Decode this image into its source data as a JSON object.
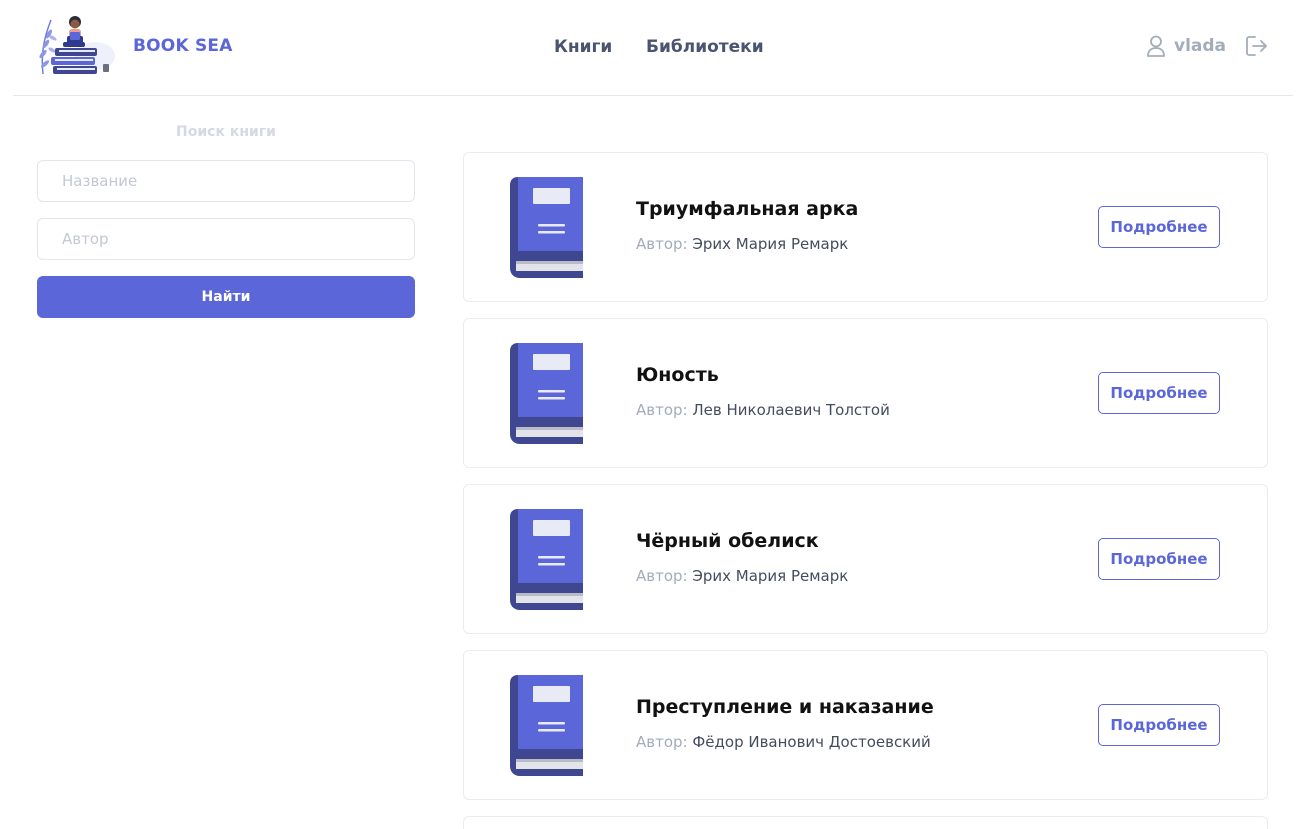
{
  "header": {
    "brand": "BOOK SEA",
    "nav": [
      "Книги",
      "Библиотеки"
    ],
    "username": "vlada"
  },
  "search": {
    "title": "Поиск книги",
    "title_placeholder": "Название",
    "author_placeholder": "Автор",
    "button": "Найти"
  },
  "books": [
    {
      "title": "Триумфальная арка",
      "author_label": "Автор:",
      "author": "Эрих Мария Ремарк",
      "button": "Подробнее"
    },
    {
      "title": "Юность",
      "author_label": "Автор:",
      "author": "Лев Николаевич Толстой",
      "button": "Подробнее"
    },
    {
      "title": "Чёрный обелиск",
      "author_label": "Автор:",
      "author": "Эрих Мария Ремарк",
      "button": "Подробнее"
    },
    {
      "title": "Преступление и наказание",
      "author_label": "Автор:",
      "author": "Фёдор Иванович Достоевский",
      "button": "Подробнее"
    }
  ],
  "colors": {
    "accent": "#5b67d8",
    "book_cover": "#5b67d8",
    "book_spine": "#3f4791"
  },
  "icons": {
    "logo": "reading-woman-on-books-logo",
    "user": "user-icon",
    "logout": "logout-icon",
    "book": "book-icon"
  }
}
